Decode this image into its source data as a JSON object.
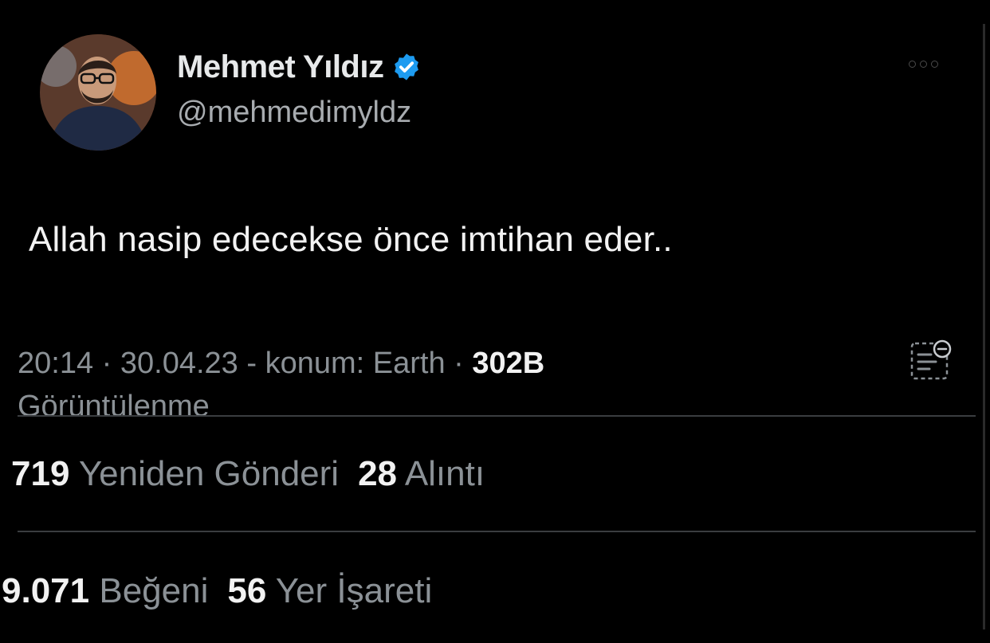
{
  "author": {
    "display_name": "Mehmet Yıldız",
    "handle": "@mehmedimyldz",
    "verified": true,
    "avatar_icon": "user-photo",
    "verified_icon": "verified-badge-icon",
    "verified_color": "#1d9bf0"
  },
  "tweet": {
    "text": "Allah nasip edecekse önce imtihan eder.."
  },
  "meta": {
    "time": "20:14",
    "date": "30.04.23",
    "location_label": "konum: Earth",
    "views_count": "302B",
    "views_label": "Görüntülenme"
  },
  "stats": {
    "reposts_count": "719",
    "reposts_label": "Yeniden Gönderi",
    "quotes_count": "28",
    "quotes_label": "Alıntı",
    "likes_count": "9.071",
    "likes_label": "Beğeni",
    "bookmarks_count": "56",
    "bookmarks_label": "Yer İşareti"
  },
  "icons": {
    "more": "more-icon",
    "analytics": "analytics-icon"
  },
  "colors": {
    "background": "#000000",
    "primary_text": "#e7e9ea",
    "secondary_text": "#8b9196",
    "divider": "#3a3d40"
  }
}
